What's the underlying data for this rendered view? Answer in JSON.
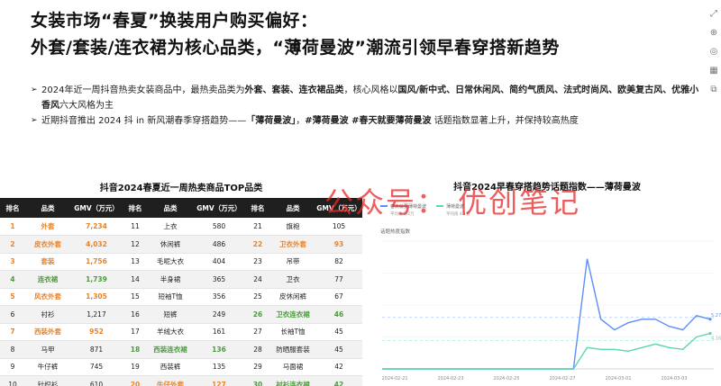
{
  "title": {
    "line1": "女装市场“春夏”换装用户购买偏好：",
    "line2": "外套/套装/连衣裙为核心品类，“薄荷曼波”潮流引领早春穿搭新趋势"
  },
  "bullets": [
    {
      "parts": [
        {
          "t": "2024年近一周抖音热卖女装商品中，最热卖品类为",
          "b": false
        },
        {
          "t": "外套、套装、连衣裙品类",
          "b": true
        },
        {
          "t": "，核心风格以",
          "b": false
        },
        {
          "t": "国风/新中式、日常休闲风、简约气质风、法式时尚风、欧美复古风、优雅小香风",
          "b": true
        },
        {
          "t": "六大风格为主",
          "b": false
        }
      ]
    },
    {
      "parts": [
        {
          "t": "近期抖音推出 2024 抖 in 新风潮春季穿搭趋势——",
          "b": false
        },
        {
          "t": "「薄荷曼波」",
          "b": true
        },
        {
          "t": "，",
          "b": false
        },
        {
          "t": "#薄荷曼波 #春天就要薄荷曼波",
          "b": true
        },
        {
          "t": " 话题指数显著上升，并保持较高热度",
          "b": false
        }
      ]
    }
  ],
  "table": {
    "title": "抖音2024春夏近一周热卖商品TOP品类",
    "headers": [
      "排名",
      "品类",
      "GMV（万元）",
      "排名",
      "品类",
      "GMV（万元）",
      "排名",
      "品类",
      "GMV（万元）"
    ],
    "rows": [
      [
        [
          "1",
          "orange"
        ],
        [
          "外套",
          "orange"
        ],
        [
          "7,234",
          "orange"
        ],
        [
          "11",
          "plain"
        ],
        [
          "上衣",
          "plain"
        ],
        [
          "580",
          "plain"
        ],
        [
          "21",
          "plain"
        ],
        [
          "旗袍",
          "plain"
        ],
        [
          "105",
          "plain"
        ]
      ],
      [
        [
          "2",
          "orange"
        ],
        [
          "皮衣外套",
          "orange"
        ],
        [
          "4,032",
          "orange"
        ],
        [
          "12",
          "plain"
        ],
        [
          "休闲裤",
          "plain"
        ],
        [
          "486",
          "plain"
        ],
        [
          "22",
          "orange"
        ],
        [
          "卫衣外套",
          "orange"
        ],
        [
          "93",
          "orange"
        ]
      ],
      [
        [
          "3",
          "orange"
        ],
        [
          "套装",
          "orange"
        ],
        [
          "1,756",
          "orange"
        ],
        [
          "13",
          "plain"
        ],
        [
          "毛呢大衣",
          "plain"
        ],
        [
          "404",
          "plain"
        ],
        [
          "23",
          "plain"
        ],
        [
          "吊带",
          "plain"
        ],
        [
          "82",
          "plain"
        ]
      ],
      [
        [
          "4",
          "green"
        ],
        [
          "连衣裙",
          "green"
        ],
        [
          "1,739",
          "green"
        ],
        [
          "14",
          "plain"
        ],
        [
          "半身裙",
          "plain"
        ],
        [
          "365",
          "plain"
        ],
        [
          "24",
          "plain"
        ],
        [
          "卫衣",
          "plain"
        ],
        [
          "77",
          "plain"
        ]
      ],
      [
        [
          "5",
          "orange"
        ],
        [
          "风衣外套",
          "orange"
        ],
        [
          "1,305",
          "orange"
        ],
        [
          "15",
          "plain"
        ],
        [
          "短袖T恤",
          "plain"
        ],
        [
          "356",
          "plain"
        ],
        [
          "25",
          "plain"
        ],
        [
          "皮休闲裤",
          "plain"
        ],
        [
          "67",
          "plain"
        ]
      ],
      [
        [
          "6",
          "plain"
        ],
        [
          "衬衫",
          "plain"
        ],
        [
          "1,217",
          "plain"
        ],
        [
          "16",
          "plain"
        ],
        [
          "短裤",
          "plain"
        ],
        [
          "249",
          "plain"
        ],
        [
          "26",
          "green"
        ],
        [
          "卫衣连衣裙",
          "green"
        ],
        [
          "46",
          "green"
        ]
      ],
      [
        [
          "7",
          "orange"
        ],
        [
          "西装外套",
          "orange"
        ],
        [
          "952",
          "orange"
        ],
        [
          "17",
          "plain"
        ],
        [
          "羊绒大衣",
          "plain"
        ],
        [
          "161",
          "plain"
        ],
        [
          "27",
          "plain"
        ],
        [
          "长袖T恤",
          "plain"
        ],
        [
          "45",
          "plain"
        ]
      ],
      [
        [
          "8",
          "plain"
        ],
        [
          "马甲",
          "plain"
        ],
        [
          "871",
          "plain"
        ],
        [
          "18",
          "green"
        ],
        [
          "西装连衣裙",
          "green"
        ],
        [
          "136",
          "green"
        ],
        [
          "28",
          "plain"
        ],
        [
          "防晒服套装",
          "plain"
        ],
        [
          "45",
          "plain"
        ]
      ],
      [
        [
          "9",
          "plain"
        ],
        [
          "牛仔裤",
          "plain"
        ],
        [
          "745",
          "plain"
        ],
        [
          "19",
          "plain"
        ],
        [
          "西装裤",
          "plain"
        ],
        [
          "135",
          "plain"
        ],
        [
          "29",
          "plain"
        ],
        [
          "马面裙",
          "plain"
        ],
        [
          "42",
          "plain"
        ]
      ],
      [
        [
          "10",
          "plain"
        ],
        [
          "针织衫",
          "plain"
        ],
        [
          "610",
          "plain"
        ],
        [
          "20",
          "orange"
        ],
        [
          "牛仔外套",
          "orange"
        ],
        [
          "127",
          "orange"
        ],
        [
          "30",
          "green"
        ],
        [
          "衬衫连衣裙",
          "green"
        ],
        [
          "42",
          "green"
        ]
      ]
    ]
  },
  "colors": {
    "orange": "#e8832a",
    "green": "#4a9a3c",
    "header_bg": "#1f1f1f",
    "line1": "#5b8ff9",
    "line2": "#5ad8a6",
    "watermark": "#e62828"
  },
  "chart_data": {
    "type": "line",
    "title": "抖音2024早春穿搭趋势话题指数——薄荷曼波",
    "legend": [
      "春天就要薄荷曼波",
      "薄荷曼波"
    ],
    "legend_values": [
      "平均值 5.2万",
      "平均值 4.1万"
    ],
    "ylabel": "话题热度指数",
    "x": [
      "2024-02-21",
      "2024-02-23",
      "2024-02-25",
      "2024-02-27",
      "2024-03-01",
      "2024-03-03"
    ],
    "series": [
      {
        "name": "春天就要薄荷曼波",
        "color": "#5b8ff9",
        "values": [
          0,
          0,
          0,
          0,
          0,
          0,
          0,
          0,
          0,
          0,
          0,
          0,
          0,
          0,
          0,
          3.1,
          1.4,
          1.1,
          1.3,
          1.4,
          1.4,
          1.2,
          1.1,
          1.5,
          1.4
        ]
      },
      {
        "name": "薄荷曼波",
        "color": "#5ad8a6",
        "values": [
          0,
          0,
          0,
          0,
          0,
          0,
          0,
          0,
          0,
          0,
          0,
          0,
          0,
          0,
          0,
          0.6,
          0.55,
          0.55,
          0.5,
          0.6,
          0.7,
          0.6,
          0.55,
          0.9,
          1.0
        ]
      }
    ],
    "end_labels": [
      "5.27",
      "4.16"
    ]
  },
  "watermark": "公众号：  优创笔记",
  "side_icons": [
    "expand-icon",
    "add-icon",
    "circle-icon",
    "grid-icon",
    "copy-icon"
  ]
}
